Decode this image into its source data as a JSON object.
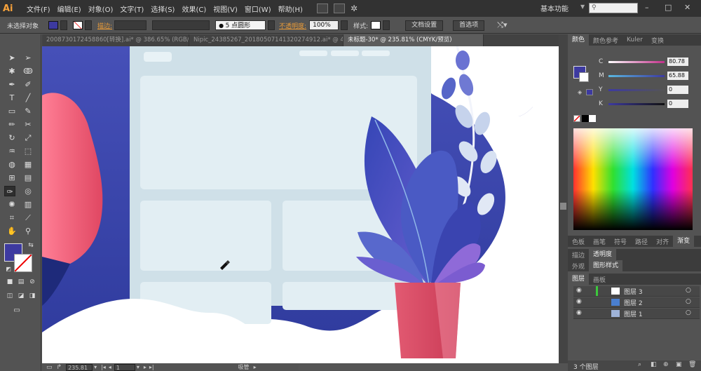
{
  "app": {
    "logo": "Ai",
    "workspace": "基本功能"
  },
  "menu": [
    "文件(F)",
    "编辑(E)",
    "对象(O)",
    "文字(T)",
    "选择(S)",
    "效果(C)",
    "视图(V)",
    "窗口(W)",
    "帮助(H)"
  ],
  "control": {
    "selection_state": "未选择对象",
    "stroke_label": "描边:",
    "point_label": "5 点圆形",
    "opacity_label": "不透明度:",
    "opacity_value": "100%",
    "style_label": "样式:",
    "doc_settings": "文档设置",
    "prefs": "首选项"
  },
  "tabs": [
    {
      "label": "20087301724588​60[转换].ai* @ 386.65% (RGB/预...",
      "active": false
    },
    {
      "label": "Nipic_24385267_20180507141320274912.ai* @ 43...",
      "active": false
    },
    {
      "label": "未标题-30* @ 235.81% (CMYK/预览)",
      "active": true
    }
  ],
  "status": {
    "zoom": "235.81",
    "page": "1",
    "tool": "吸管"
  },
  "color_panel": {
    "tabs": [
      "颜色",
      "颜色参考",
      "Kuler",
      "变换"
    ],
    "channels": [
      {
        "label": "C",
        "value": "80.78",
        "color": "#c22f8a"
      },
      {
        "label": "M",
        "value": "65.88",
        "color": "#2fb7c9"
      },
      {
        "label": "Y",
        "value": "0",
        "color": "#777777"
      },
      {
        "label": "K",
        "value": "0",
        "color": "#222222"
      }
    ],
    "fill_color": "#3d3aa0"
  },
  "panel_groups": [
    {
      "tabs": [
        "色板",
        "画笔",
        "符号",
        "路径",
        "对齐",
        "渐变"
      ]
    },
    {
      "tabs": [
        "描边",
        "透明度"
      ]
    },
    {
      "tabs": [
        "外观",
        "图形样式"
      ]
    },
    {
      "tabs": [
        "图层",
        "画板"
      ]
    }
  ],
  "layers": [
    {
      "name": "图层 3"
    },
    {
      "name": "图层 2"
    },
    {
      "name": "图层 1"
    }
  ],
  "layers_count": "3 个图层",
  "colors": {
    "accent": "#3d3aa0",
    "pot": "#d94a64",
    "window": "#dde9ef"
  }
}
